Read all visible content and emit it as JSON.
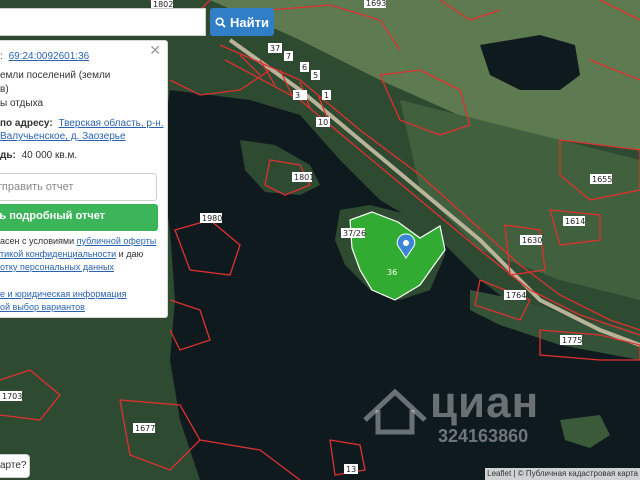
{
  "search": {
    "button_label": "Найти",
    "query": ""
  },
  "panel": {
    "cadastral_label": ":",
    "cadastral_number": "69:24:0092601:36",
    "category_line1": "емли поселений (земли",
    "category_line2": "в)",
    "usage": "ы отдыха",
    "address_label": "по адресу:",
    "address_line1": "Тверская область, р-н.",
    "address_line2": "Валучьенское, д. Заозерье",
    "area_label": "дь:",
    "area_value": "40 000 кв.м.",
    "report_input_placeholder": "отправить отчет",
    "report_button_label": "ть подробный отчет",
    "consent_prefix": "асен с условиями",
    "consent_link1": "публичной оферты",
    "consent_link2": "тикой конфиденциальности",
    "consent_mid": "и даю",
    "consent_link3": "отку персональных данных",
    "legal_link1": "е и юридическая информация",
    "legal_link2": "ой выбор вариантов"
  },
  "question_button": "арте?",
  "watermark": {
    "brand": "циан",
    "listing_id": "324163860"
  },
  "attribution": "Leaflet | © Публичная кадастровая карта",
  "map_labels": [
    "1802",
    "1693",
    "37",
    "7",
    "6",
    "5",
    "3",
    "1",
    "10",
    "1801",
    "1980",
    "1655",
    "1614",
    "1630",
    "1764",
    "1775",
    "1703",
    "1677",
    "13",
    "36",
    "37/26"
  ],
  "colors": {
    "parcel_border": "#e03030",
    "selected_fill": "#33cc33",
    "marker": "#3a86d4",
    "water": "#0f1a1f",
    "forest": "#2b4a30"
  }
}
